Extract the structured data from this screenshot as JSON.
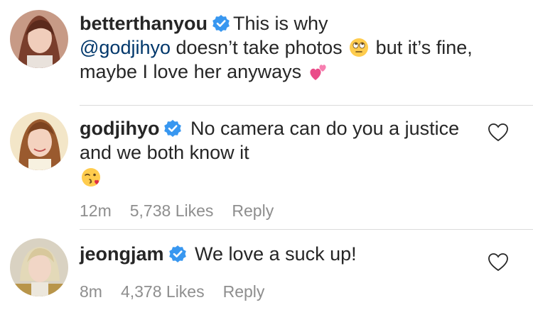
{
  "comments": [
    {
      "username": "betterthanyou",
      "verified": true,
      "text_before": "This is why ",
      "mention": "@godjihyo",
      "text_after": " doesn’t take photos ",
      "emoji1": "face-with-rolling-eyes",
      "text_after2": " but it’s fine, maybe I love her anyways ",
      "emoji2": "two-hearts"
    },
    {
      "username": "godjihyo",
      "verified": true,
      "text": "No camera can do you a justice and we both know it",
      "emoji": "face-blowing-kiss",
      "time": "12m",
      "likes": "5,738 Likes",
      "reply": "Reply"
    },
    {
      "username": "jeongjam",
      "verified": true,
      "text": "We love a suck up!",
      "time": "8m",
      "likes": "4,378 Likes",
      "reply": "Reply"
    }
  ],
  "colors": {
    "text": "#262626",
    "meta": "#8e8e8e",
    "mention": "#00376b",
    "verified": "#3897f0",
    "divider": "#dbdbdb"
  }
}
